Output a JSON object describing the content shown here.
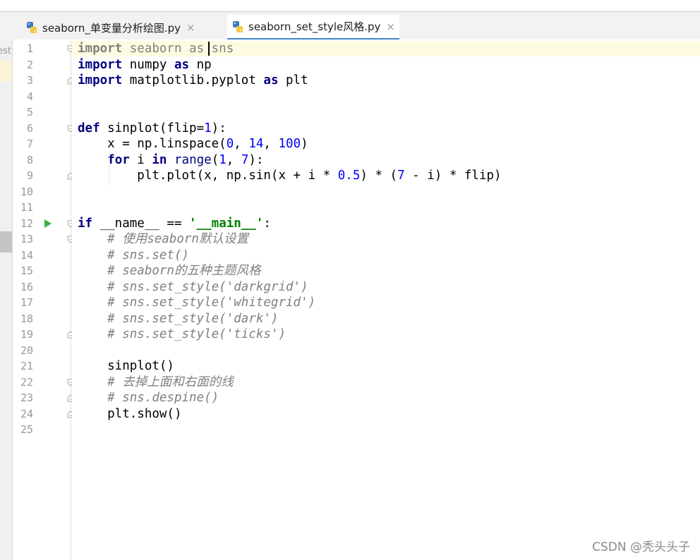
{
  "tabs": [
    {
      "label": "seaborn_单变量分析绘图.py",
      "close": "×"
    },
    {
      "label": "seaborn_set_style风格.py",
      "close": "×"
    }
  ],
  "left_panel_fragment": "est",
  "line_numbers": [
    "1",
    "2",
    "3",
    "4",
    "5",
    "6",
    "7",
    "8",
    "9",
    "10",
    "11",
    "12",
    "13",
    "14",
    "15",
    "16",
    "17",
    "18",
    "19",
    "20",
    "21",
    "22",
    "23",
    "24",
    "25"
  ],
  "code": {
    "l1": {
      "kw": "import",
      "rest": " seaborn as sns"
    },
    "l2": {
      "kw": "import",
      "mid": " numpy ",
      "kw2": "as",
      "rest": " np"
    },
    "l3": {
      "kw": "import",
      "mid": " matplotlib.pyplot ",
      "kw2": "as",
      "rest": " plt"
    },
    "l6": {
      "kw": "def",
      "mid": " sinplot(flip=",
      "num": "1",
      "rest": "):"
    },
    "l7": {
      "a": "    x = np.linspace(",
      "n1": "0",
      "b": ", ",
      "n2": "14",
      "c": ", ",
      "n3": "100",
      "d": ")"
    },
    "l8": {
      "ind": "    ",
      "kw": "for",
      "a": " i ",
      "kw2": "in",
      "sp": " ",
      "bi": "range",
      "b": "(",
      "n1": "1",
      "c": ", ",
      "n2": "7",
      "d": "):"
    },
    "l9": {
      "a": "        plt.plot(x, np.sin(x + i * ",
      "n1": "0.5",
      "b": ") * (",
      "n2": "7",
      "c": " - i) * flip)"
    },
    "l12": {
      "kw": "if",
      "a": " __name__ == ",
      "str": "'__main__'",
      "b": ":"
    },
    "l13": "    # 使用seaborn默认设置",
    "l14": "    # sns.set()",
    "l15": "    # seaborn的五种主题风格",
    "l16": "    # sns.set_style('darkgrid')",
    "l17": "    # sns.set_style('whitegrid')",
    "l18": "    # sns.set_style('dark')",
    "l19": "    # sns.set_style('ticks')",
    "l21": "    sinplot()",
    "l22": "    # 去掉上面和右面的线",
    "l23": "    # sns.despine()",
    "l24": "    plt.show()"
  },
  "watermark": "CSDN @秃头头子",
  "colors": {
    "keyword": "#000080",
    "number": "#0000ff",
    "string": "#008000",
    "comment": "#808080",
    "tab_underline": "#4083c9"
  }
}
